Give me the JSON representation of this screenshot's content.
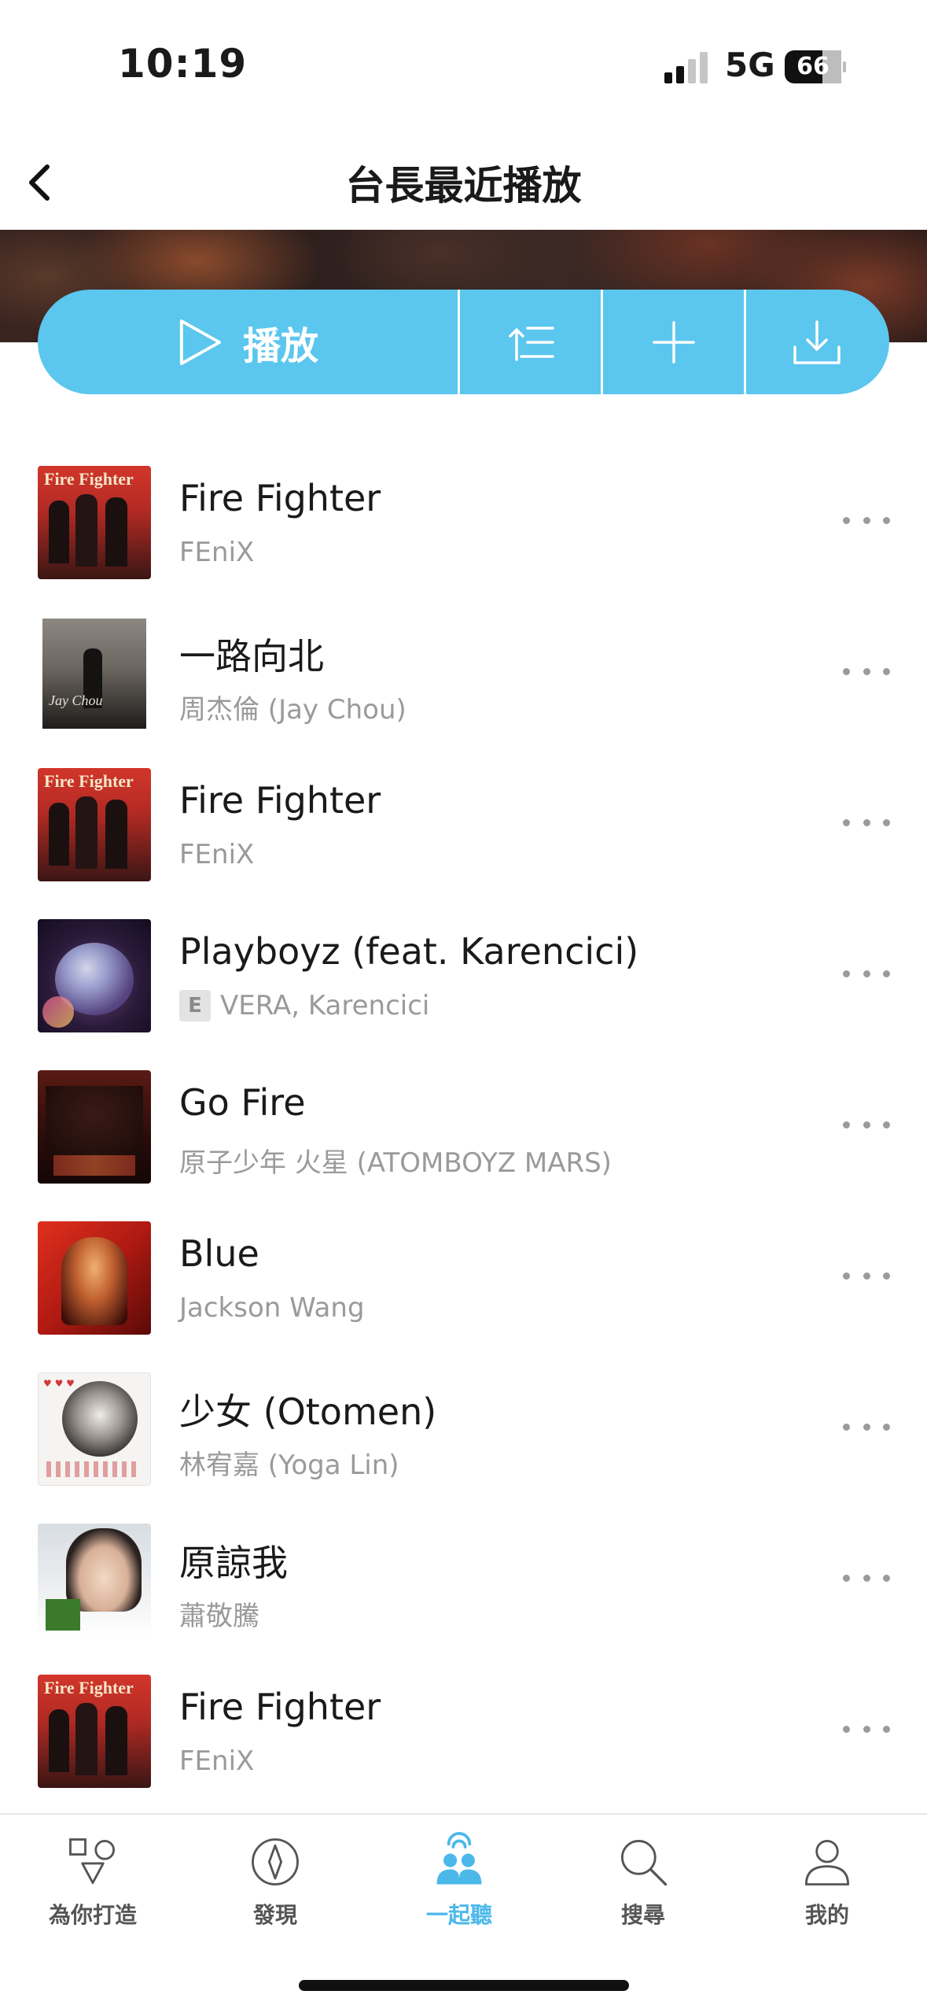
{
  "status_bar": {
    "time": "10:19",
    "network": "5G",
    "battery": "66"
  },
  "header": {
    "title": "台長最近播放",
    "back_icon": "chevron-left-icon"
  },
  "actions": {
    "play_label": "播放",
    "play_icon": "play-icon",
    "queue_icon": "add-to-queue-icon",
    "add_icon": "plus-icon",
    "download_icon": "download-icon",
    "accent": "#5bc6ee"
  },
  "songs": [
    {
      "title": "Fire Fighter",
      "artist": "FEniX",
      "explicit": false
    },
    {
      "title": "一路向北",
      "artist": "周杰倫 (Jay Chou)",
      "explicit": false
    },
    {
      "title": "Fire Fighter",
      "artist": "FEniX",
      "explicit": false
    },
    {
      "title": "Playboyz (feat. Karencici)",
      "artist": "VERA, Karencici",
      "explicit": true,
      "explicit_label": "E"
    },
    {
      "title": "Go Fire",
      "artist": "原子少年 火星 (ATOMBOYZ MARS)",
      "explicit": false
    },
    {
      "title": "Blue",
      "artist": "Jackson Wang",
      "explicit": false
    },
    {
      "title": "少女 (Otomen)",
      "artist": "林宥嘉 (Yoga Lin)",
      "explicit": false
    },
    {
      "title": "原諒我",
      "artist": "蕭敬騰",
      "explicit": false
    },
    {
      "title": "Fire Fighter",
      "artist": "FEniX",
      "explicit": false
    }
  ],
  "tabs": [
    {
      "label": "為你打造",
      "icon": "shapes-icon"
    },
    {
      "label": "發現",
      "icon": "compass-icon"
    },
    {
      "label": "一起聽",
      "icon": "listen-together-icon",
      "active": true
    },
    {
      "label": "搜尋",
      "icon": "search-icon"
    },
    {
      "label": "我的",
      "icon": "profile-icon"
    }
  ],
  "colors": {
    "active_tab": "#4cb8ea",
    "secondary_text": "#9a9a9a"
  }
}
